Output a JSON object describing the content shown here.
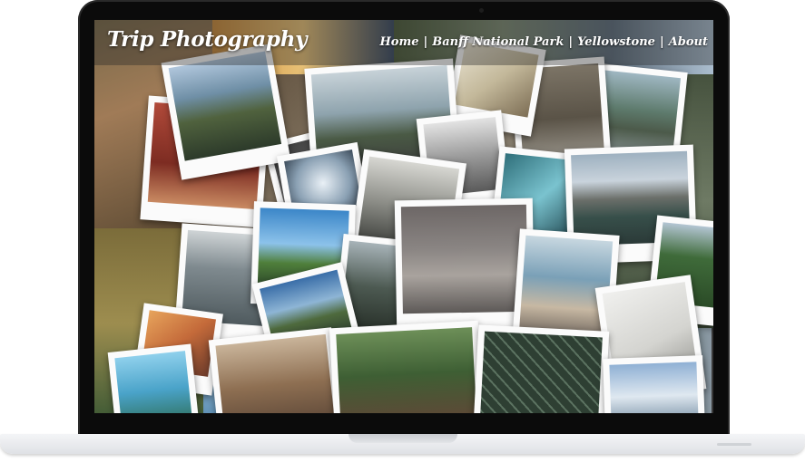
{
  "site": {
    "title": "Trip Photography"
  },
  "nav": {
    "items": [
      {
        "label": "Home"
      },
      {
        "label": "Banff National Park"
      },
      {
        "label": "Yellowstone"
      },
      {
        "label": "About"
      }
    ],
    "separator": "|"
  },
  "colors": {
    "bezel": "#0b0b0b",
    "base": "#e4e6e9",
    "nav_text": "#ffffff"
  }
}
